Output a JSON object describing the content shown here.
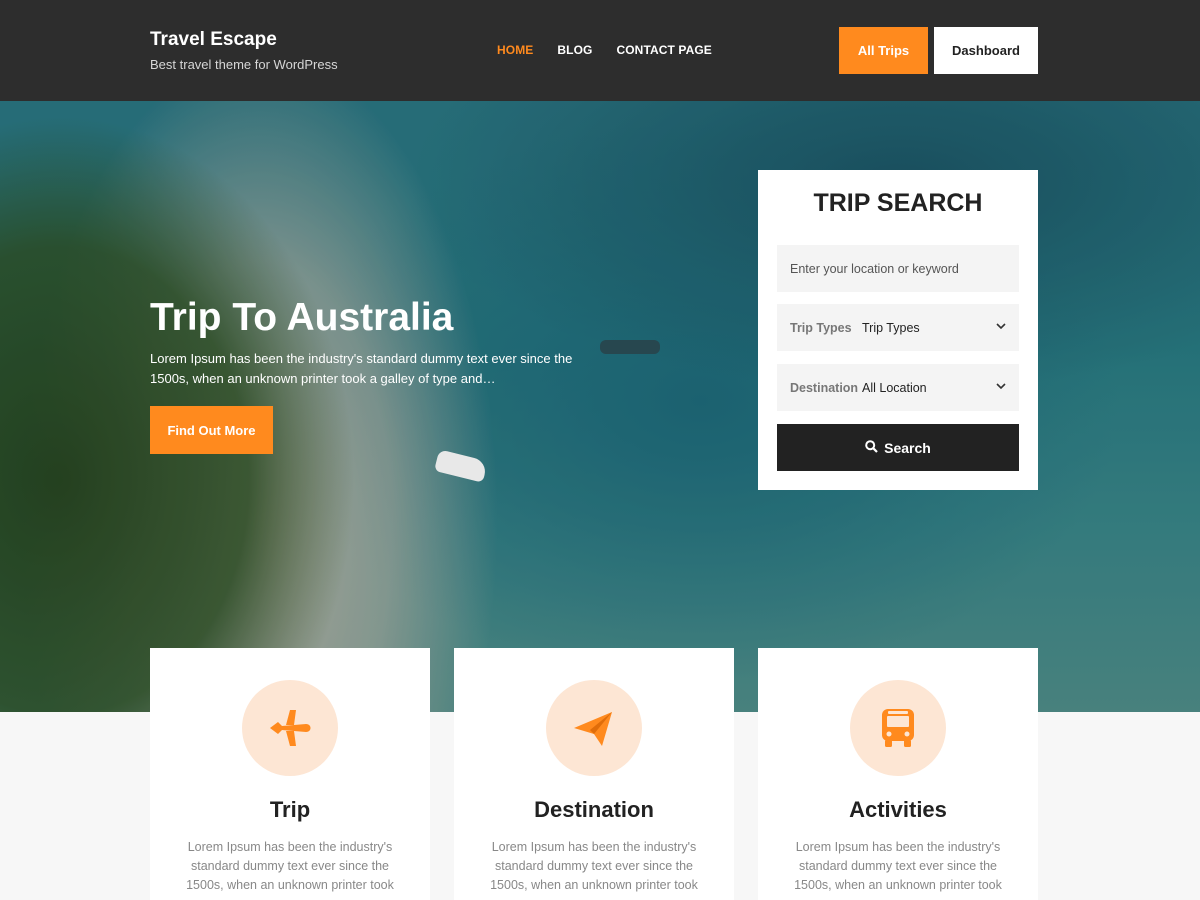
{
  "site": {
    "title": "Travel Escape",
    "tagline": "Best travel theme for WordPress"
  },
  "nav": {
    "items": [
      {
        "label": "HOME",
        "active": true
      },
      {
        "label": "BLOG",
        "active": false
      },
      {
        "label": "CONTACT PAGE",
        "active": false
      }
    ]
  },
  "header_buttons": {
    "all_trips": "All Trips",
    "dashboard": "Dashboard"
  },
  "hero": {
    "title": "Trip To Australia",
    "text": "Lorem Ipsum has been the industry's standard dummy text ever since the 1500s, when an unknown printer took a galley of type and…",
    "button": "Find Out More"
  },
  "trip_search": {
    "title": "TRIP SEARCH",
    "keyword_placeholder": "Enter your location or keyword",
    "types_label": "Trip Types",
    "types_value": "Trip Types",
    "destination_label": "Destination",
    "destination_value": "All Location",
    "button": "Search"
  },
  "features": [
    {
      "icon": "airplane-icon",
      "title": "Trip",
      "text": "Lorem Ipsum has been the industry's standard dummy text ever since the 1500s, when an unknown printer took"
    },
    {
      "icon": "paper-plane-icon",
      "title": "Destination",
      "text": "Lorem Ipsum has been the industry's standard dummy text ever since the 1500s, when an unknown printer took"
    },
    {
      "icon": "bus-icon",
      "title": "Activities",
      "text": "Lorem Ipsum has been the industry's standard dummy text ever since the 1500s, when an unknown printer took"
    }
  ],
  "colors": {
    "accent": "#ff8a1e",
    "header_bg": "#2d2d2d",
    "icon_circle": "#fde6d4"
  }
}
